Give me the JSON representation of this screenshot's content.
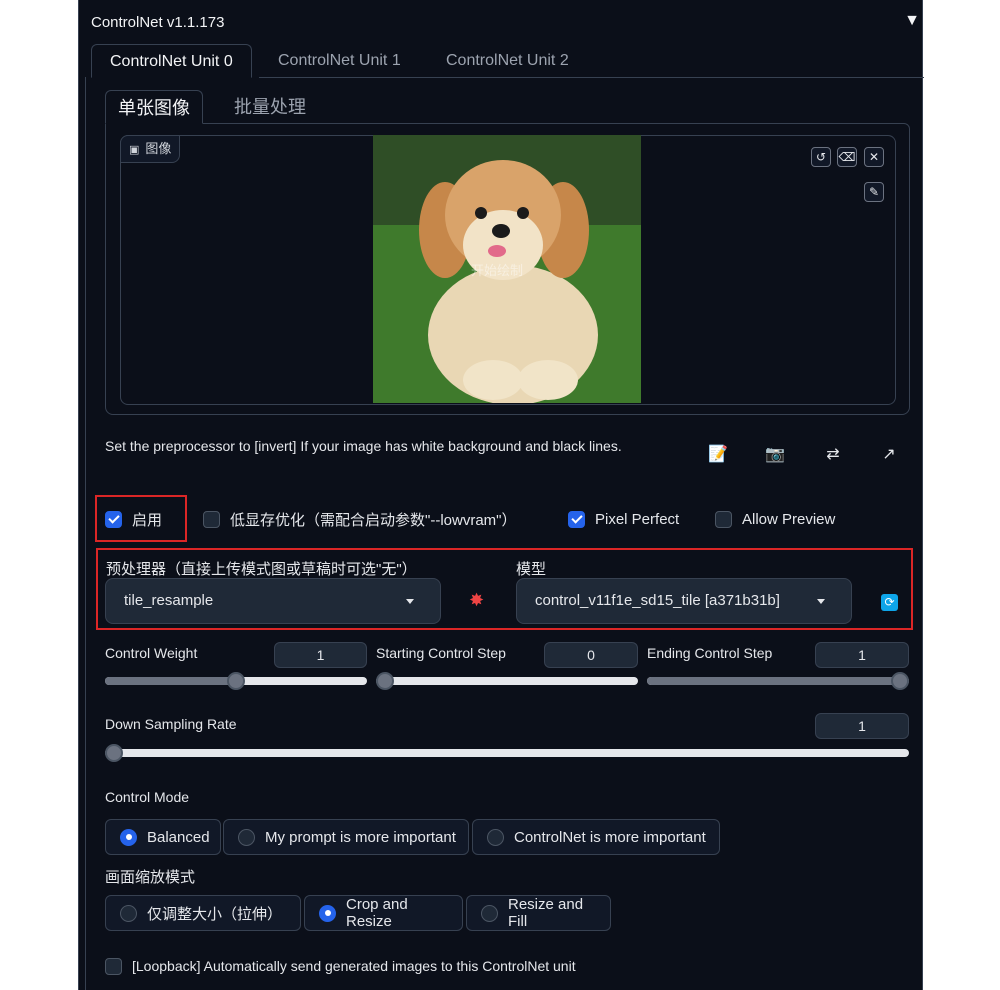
{
  "header": {
    "title": "ControlNet v1.1.173",
    "collapse_icon": "▼"
  },
  "unit_tabs": [
    "ControlNet Unit 0",
    "ControlNet Unit 1",
    "ControlNet Unit 2"
  ],
  "image_tabs": [
    "单张图像",
    "批量处理"
  ],
  "image_panel": {
    "label": "图像",
    "watermark": "开始绘制"
  },
  "image_tools": {
    "undo": "↺",
    "erase": "⌫",
    "close": "✕",
    "pen": "✎"
  },
  "hint": "Set the preprocessor to [invert] If your image has white background and black lines.",
  "toolbar_icons": {
    "edit": "📝",
    "camera": "📷",
    "swap": "⇄",
    "send": "↗"
  },
  "options": {
    "enable": "启用",
    "lowvram": "低显存优化（需配合启动参数\"--lowvram\"）",
    "pixel_perfect": "Pixel Perfect",
    "allow_preview": "Allow Preview"
  },
  "preprocessor": {
    "label": "预处理器（直接上传模式图或草稿时可选\"无\"）",
    "value": "tile_resample"
  },
  "model": {
    "label": "模型",
    "value": "control_v11f1e_sd15_tile [a371b31b]"
  },
  "sliders": {
    "control_weight": {
      "label": "Control Weight",
      "value": "1",
      "fraction": 0.5
    },
    "starting_step": {
      "label": "Starting Control Step",
      "value": "0",
      "fraction": 0.0
    },
    "ending_step": {
      "label": "Ending Control Step",
      "value": "1",
      "fraction": 1.0
    },
    "down_sampling": {
      "label": "Down Sampling Rate",
      "value": "1",
      "fraction": 0.0
    }
  },
  "control_mode": {
    "label": "Control Mode",
    "options": [
      "Balanced",
      "My prompt is more important",
      "ControlNet is more important"
    ],
    "selected": "Balanced"
  },
  "resize_mode": {
    "label": "画面缩放模式",
    "options": [
      "仅调整大小（拉伸）",
      "Crop and Resize",
      "Resize and Fill"
    ],
    "selected": "Crop and Resize"
  },
  "loopback": "[Loopback] Automatically send generated images to this ControlNet unit",
  "colors": {
    "accent": "#2563eb",
    "highlight": "#dc2626",
    "background": "#0b0f19"
  }
}
